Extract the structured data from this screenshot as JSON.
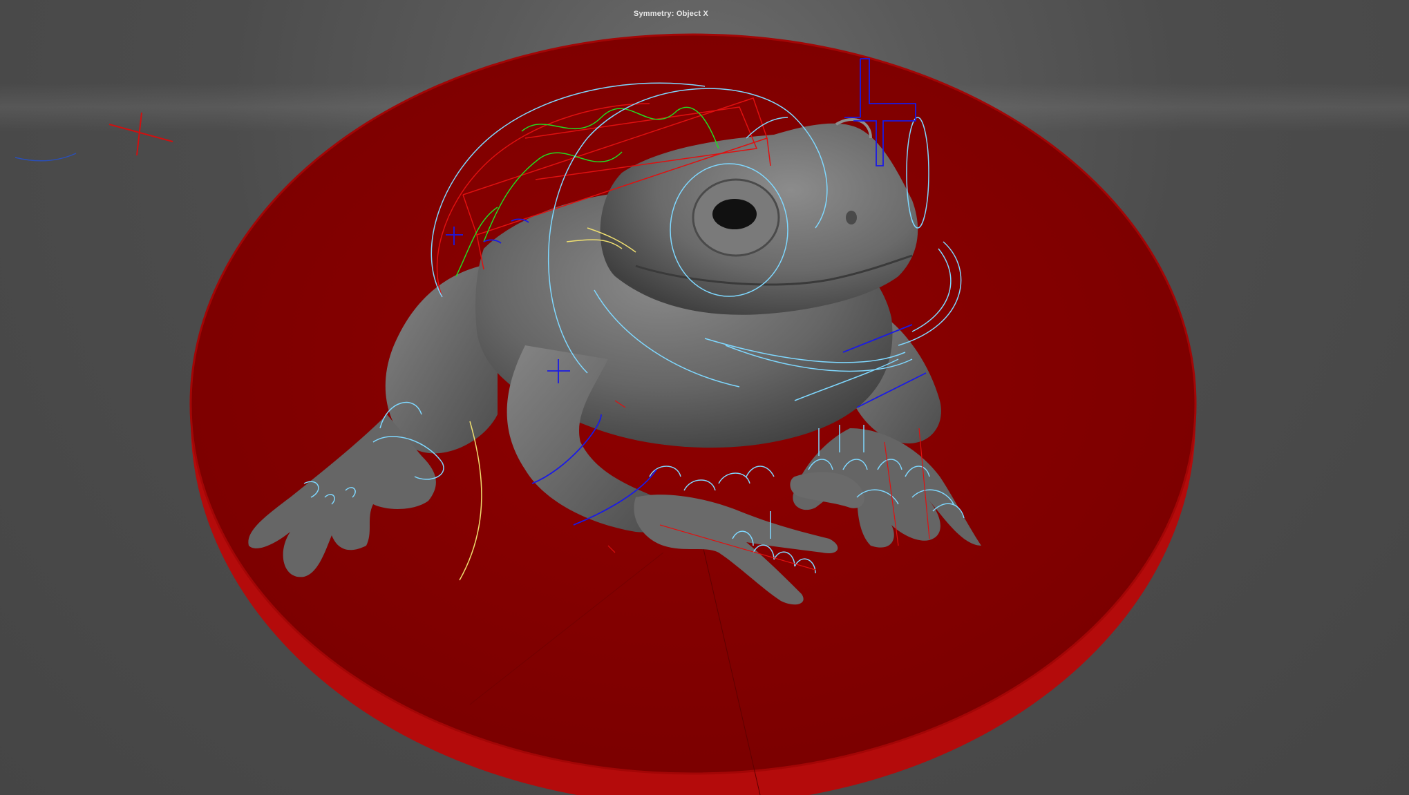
{
  "viewport": {
    "hud": {
      "symmetry_label": "Symmetry: Object X"
    },
    "colors": {
      "background": "#4a4a4a",
      "pedestal_top": "#8b0000",
      "pedestal_side": "#b40a0a",
      "model_gray": "#6b6b6b",
      "control_cyan": "#7fd8ff",
      "control_blue": "#1a1ae6",
      "control_red": "#e01010",
      "control_green": "#22dd22",
      "control_yellow": "#f0e070",
      "hud_text": "#e8e8e8"
    },
    "scene": {
      "model": "frog-sculpt",
      "base": "red-cylinder-pedestal",
      "rig_controls": [
        "cyan-curve-controls",
        "blue-locator-crosses",
        "red-bounding-cage",
        "green-spline-curves",
        "yellow-curves"
      ]
    }
  }
}
